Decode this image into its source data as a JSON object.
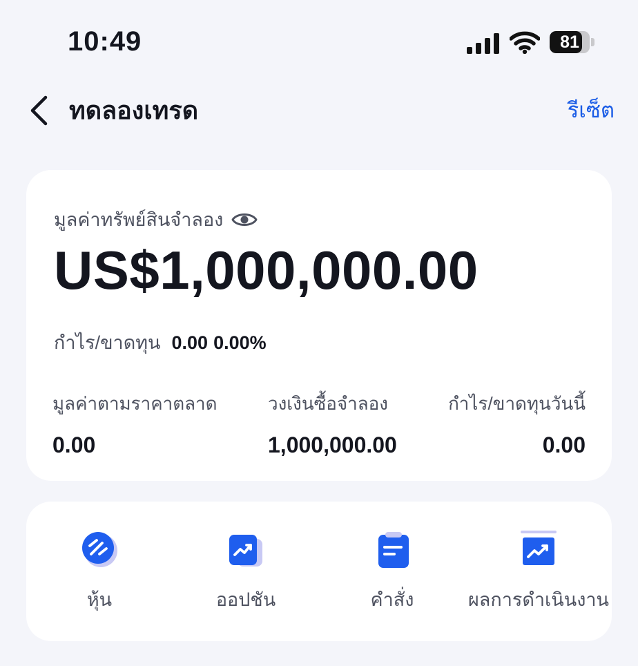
{
  "status_bar": {
    "time": "10:49",
    "battery": "81"
  },
  "nav": {
    "title": "ทดลองเทรด",
    "reset": "รีเซ็ต"
  },
  "summary": {
    "asset_label": "มูลค่าทรัพย์สินจำลอง",
    "asset_value": "US$1,000,000.00",
    "pnl_label": "กำไร/ขาดทุน",
    "pnl_value": "0.00",
    "pnl_percent": "0.00%",
    "stats": [
      {
        "label": "มูลค่าตามราคาตลาด",
        "value": "0.00"
      },
      {
        "label": "วงเงินซื้อจำลอง",
        "value": "1,000,000.00"
      },
      {
        "label": "กำไร/ขาดทุนวันนี้",
        "value": "0.00"
      }
    ]
  },
  "actions": [
    {
      "label": "หุ้น",
      "icon": "stock-icon"
    },
    {
      "label": "ออปชัน",
      "icon": "option-chart-icon"
    },
    {
      "label": "คำสั่ง",
      "icon": "order-clipboard-icon"
    },
    {
      "label": "ผลการดำเนินงาน",
      "icon": "performance-chart-icon"
    }
  ],
  "colors": {
    "accent": "#1a5ce6",
    "background": "#f4f5fa",
    "card": "#ffffff",
    "text_primary": "#14161f",
    "text_secondary": "#4e5260"
  }
}
